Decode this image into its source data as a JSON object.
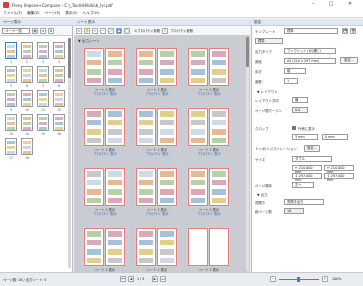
{
  "window": {
    "title": "Flexy Impose+Compose - C:\\_Tools\\Hibiki\\b_Ivi.pdf",
    "controls": [
      "–",
      "□",
      "✕"
    ]
  },
  "menu": [
    "ファイル(F)",
    "編集(E)",
    "ページ(P)",
    "表示(V)",
    "ヘルプ(H)"
  ],
  "left_pane": {
    "header": "ページ表示",
    "selector": "ページ一覧",
    "thumb_numbers": [
      "1",
      "2",
      "3",
      "4",
      "5",
      "6",
      "7",
      "8",
      "9",
      "10",
      "11",
      "12",
      "13",
      "14",
      "15",
      "16",
      "17",
      "18"
    ]
  },
  "mid_pane": {
    "header": "シート表示",
    "tool_text1": "1/プロパティ参照",
    "tool_text2": "プロパティ参照",
    "section_title": "▼ 出力シート",
    "page_caption": "シート 1 表示",
    "page_link": "プロパティ 表示"
  },
  "right_pane": {
    "header": "設定",
    "template_label": "テンプレート",
    "template_value": "標準",
    "output_type_label": "出力タイプ",
    "output_type_value": "ブックレット(1片綴じ)",
    "paper_label": "用紙",
    "paper_value": "A4 (210 x 297 mm)",
    "paper_button": "設定...",
    "orientation_label": "向き",
    "orientation_value": "縦",
    "pages_label": "面数",
    "pages_value": "1",
    "layout_section": "▼ レイアウト",
    "layout_type_label": "レイアウト方向",
    "layout_type_value": "横",
    "layout_margin_label": "ページ間マージン",
    "layout_margin_value": "0.0",
    "crop_label": "クロップ",
    "crop_check_label": "外側に表示",
    "crop_value1": "3 mm",
    "crop_value2": "0 mm",
    "marks_label": "トンボ/レジストレーション",
    "marks_button": "設定...",
    "size_label": "サイズ",
    "size_value": "ダブル",
    "dim_w": "↔ 210.000 mm",
    "dim_h": "↕ 297.000 mm",
    "dim_w2": "↔ 210.000 mm",
    "dim_h2": "↕ 297.000 mm",
    "page_order_label": "ページ順序",
    "page_order_value": "左→",
    "output_section": "▼ 出力",
    "spread_label": "見開き",
    "spread_value": "見開き出力",
    "total_label": "総ページ数",
    "total_value": "18"
  },
  "status": {
    "left": "ページ数: 18 / 出力シート: 5",
    "zoom": "100%",
    "page_nav": "1 / 5"
  },
  "colors": {
    "accent": "#3a7bd5",
    "page_border": "#e87c7c",
    "link": "#2766c4"
  }
}
